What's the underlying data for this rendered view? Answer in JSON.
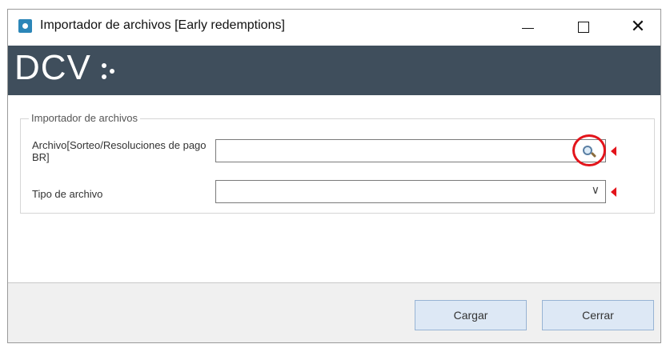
{
  "window": {
    "title": "Importador de archivos [Early redemptions]",
    "minimize_glyph": "—",
    "maximize_glyph": "☐",
    "close_glyph": "✕"
  },
  "banner": {
    "logo_text": "DCV",
    "background_color": "#3f4e5c"
  },
  "form": {
    "group_title": "Importador de archivos",
    "archivo_label": "Archivo[Sorteo/Resoluciones de pago BR]",
    "archivo_value": "",
    "tipo_label": "Tipo de archivo",
    "tipo_value": "",
    "search_icon": "magnifier-icon",
    "required_marker_color": "#e3141b"
  },
  "footer": {
    "cargar_label": "Cargar",
    "cerrar_label": "Cerrar"
  }
}
